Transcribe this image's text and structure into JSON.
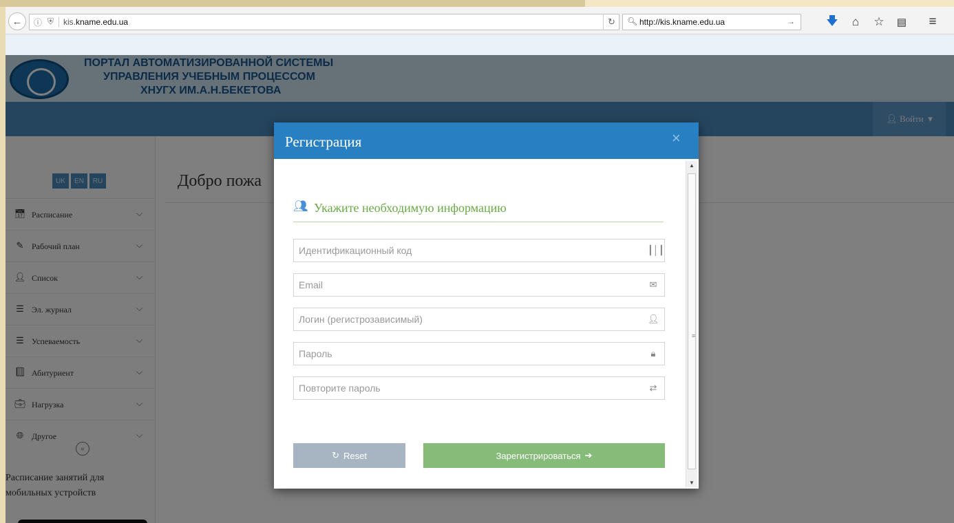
{
  "browser": {
    "url_prefix": "kis.",
    "url_domain": "kname.edu.ua",
    "search_text": "http://kis.kname.edu.ua",
    "icons": [
      "back-arrow-icon",
      "info-icon",
      "shield-icon",
      "reload-icon",
      "search-icon",
      "go-arrow-icon",
      "download-icon",
      "home-icon",
      "bookmark-star-icon",
      "reading-list-icon",
      "menu-icon"
    ]
  },
  "header": {
    "title_line1": "ПОРТАЛ АВТОМАТИЗИРОВАННОЙ СИСТЕМЫ",
    "title_line2": "УПРАВЛЕНИЯ УЧЕБНЫМ ПРОЦЕССОМ",
    "title_line3": "ХНУГХ ИМ.А.Н.БЕКЕТОВА",
    "login_label": "Войти"
  },
  "languages": [
    "UK",
    "EN",
    "RU"
  ],
  "sidebar": {
    "items": [
      {
        "label": "Расписание",
        "icon": "calendar-icon"
      },
      {
        "label": "Рабочий план",
        "icon": "edit-icon"
      },
      {
        "label": "Список",
        "icon": "user-icon"
      },
      {
        "label": "Эл. журнал",
        "icon": "list-icon"
      },
      {
        "label": "Успеваемость",
        "icon": "list-icon"
      },
      {
        "label": "Абитуриент",
        "icon": "book-icon"
      },
      {
        "label": "Нагрузка",
        "icon": "briefcase-icon"
      },
      {
        "label": "Другое",
        "icon": "globe-icon"
      }
    ],
    "mobile_text": "Расписание занятий для мобильных устройств"
  },
  "main": {
    "welcome": "Добро пожа"
  },
  "modal": {
    "title": "Регистрация",
    "section_title": "Укажите необходимую информацию",
    "fields": {
      "id_code": {
        "placeholder": "Идентификационный код",
        "value": "",
        "icon": "barcode-icon"
      },
      "email": {
        "placeholder": "Email",
        "value": "",
        "icon": "envelope-icon"
      },
      "login": {
        "placeholder": "Логин (регистрозависимый)",
        "value": "",
        "icon": "user-icon"
      },
      "password": {
        "placeholder": "Пароль",
        "value": "",
        "icon": "lock-icon"
      },
      "password_repeat": {
        "placeholder": "Повторите пароль",
        "value": "",
        "icon": "retweet-icon"
      }
    },
    "reset_label": "Reset",
    "register_label": "Зарегистрироваться"
  },
  "colors": {
    "modal_header": "#2880c3",
    "section_title": "#69aa46",
    "register_button": "#87bb7a",
    "reset_button": "#a7b5c2"
  }
}
